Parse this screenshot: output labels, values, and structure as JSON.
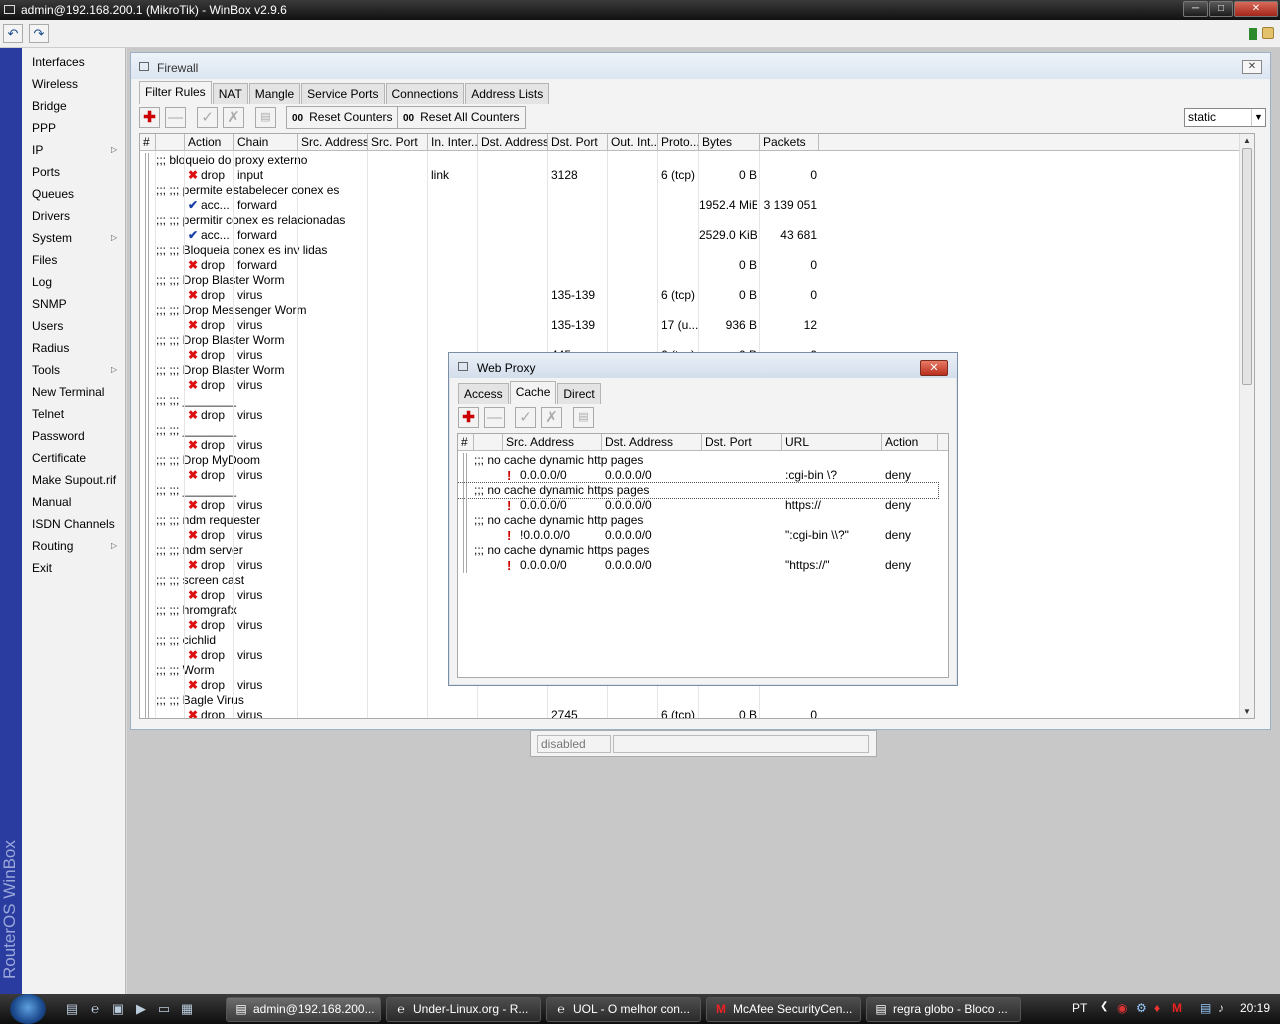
{
  "window": {
    "title": "admin@192.168.200.1 (MikroTik) - WinBox v2.9.6",
    "brand": "RouterOS WinBox"
  },
  "toolbar": {
    "undo_icon": "undo-icon",
    "redo_icon": "redo-icon"
  },
  "sidebar": {
    "items": [
      {
        "label": "Interfaces",
        "submenu": false
      },
      {
        "label": "Wireless",
        "submenu": false
      },
      {
        "label": "Bridge",
        "submenu": false
      },
      {
        "label": "PPP",
        "submenu": false
      },
      {
        "label": "IP",
        "submenu": true
      },
      {
        "label": "Ports",
        "submenu": false
      },
      {
        "label": "Queues",
        "submenu": false
      },
      {
        "label": "Drivers",
        "submenu": false
      },
      {
        "label": "System",
        "submenu": true
      },
      {
        "label": "Files",
        "submenu": false
      },
      {
        "label": "Log",
        "submenu": false
      },
      {
        "label": "SNMP",
        "submenu": false
      },
      {
        "label": "Users",
        "submenu": false
      },
      {
        "label": "Radius",
        "submenu": false
      },
      {
        "label": "Tools",
        "submenu": true
      },
      {
        "label": "New Terminal",
        "submenu": false
      },
      {
        "label": "Telnet",
        "submenu": false
      },
      {
        "label": "Password",
        "submenu": false
      },
      {
        "label": "Certificate",
        "submenu": false
      },
      {
        "label": "Make Supout.rif",
        "submenu": false
      },
      {
        "label": "Manual",
        "submenu": false
      },
      {
        "label": "ISDN Channels",
        "submenu": false
      },
      {
        "label": "Routing",
        "submenu": true
      },
      {
        "label": "Exit",
        "submenu": false
      }
    ]
  },
  "firewall": {
    "title": "Firewall",
    "tabs": [
      "Filter Rules",
      "NAT",
      "Mangle",
      "Service Ports",
      "Connections",
      "Address Lists"
    ],
    "active_tab": "Filter Rules",
    "reset_counters": "Reset Counters",
    "reset_all_counters": "Reset All Counters",
    "counter_prefix": "00",
    "filter_select": "static",
    "columns": [
      "#",
      "Action",
      "Chain",
      "Src. Address",
      "Src. Port",
      "In. Inter...",
      "Dst. Address",
      "Dst. Port",
      "Out. Int...",
      "Proto...",
      "Bytes",
      "Packets"
    ],
    "rows": [
      {
        "comment": ";;; bloqueio do proxy externo",
        "icon": "x",
        "action": "drop",
        "chain": "input",
        "in_iface": "link",
        "dst_port": "3128",
        "proto": "6 (tcp)",
        "bytes": "0 B",
        "packets": "0"
      },
      {
        "comment": ";;; ;;; permite estabelecer conex es",
        "icon": "ok",
        "action": "acc...",
        "chain": "forward",
        "in_iface": "",
        "dst_port": "",
        "proto": "",
        "bytes": "1952.4 MiB",
        "packets": "3 139 051"
      },
      {
        "comment": ";;; ;;; permitir conex es relacionadas",
        "icon": "ok",
        "action": "acc...",
        "chain": "forward",
        "in_iface": "",
        "dst_port": "",
        "proto": "",
        "bytes": "2529.0 KiB",
        "packets": "43 681"
      },
      {
        "comment": ";;; ;;; Bloqueia conex es inv lidas",
        "icon": "x",
        "action": "drop",
        "chain": "forward",
        "in_iface": "",
        "dst_port": "",
        "proto": "",
        "bytes": "0 B",
        "packets": "0"
      },
      {
        "comment": ";;; ;;; Drop Blaster Worm",
        "icon": "x",
        "action": "drop",
        "chain": "virus",
        "in_iface": "",
        "dst_port": "135-139",
        "proto": "6 (tcp)",
        "bytes": "0 B",
        "packets": "0"
      },
      {
        "comment": ";;; ;;; Drop Messenger Worm",
        "icon": "x",
        "action": "drop",
        "chain": "virus",
        "in_iface": "",
        "dst_port": "135-139",
        "proto": "17 (u...",
        "bytes": "936 B",
        "packets": "12"
      },
      {
        "comment": ";;; ;;; Drop Blaster Worm",
        "icon": "x",
        "action": "drop",
        "chain": "virus",
        "in_iface": "",
        "dst_port": "445",
        "proto": "6 (tcp)",
        "bytes": "0 B",
        "packets": "0"
      },
      {
        "comment": ";;; ;;; Drop Blaster Worm",
        "icon": "x",
        "action": "drop",
        "chain": "virus",
        "in_iface": "",
        "dst_port": "",
        "proto": "",
        "bytes": "",
        "packets": ""
      },
      {
        "comment": ";;; ;;; ________",
        "icon": "x",
        "action": "drop",
        "chain": "virus",
        "in_iface": "",
        "dst_port": "",
        "proto": "",
        "bytes": "",
        "packets": ""
      },
      {
        "comment": ";;; ;;; ________",
        "icon": "x",
        "action": "drop",
        "chain": "virus",
        "in_iface": "",
        "dst_port": "",
        "proto": "",
        "bytes": "",
        "packets": ""
      },
      {
        "comment": ";;; ;;; Drop MyDoom",
        "icon": "x",
        "action": "drop",
        "chain": "virus",
        "in_iface": "",
        "dst_port": "",
        "proto": "",
        "bytes": "",
        "packets": ""
      },
      {
        "comment": ";;; ;;; ________",
        "icon": "x",
        "action": "drop",
        "chain": "virus",
        "in_iface": "",
        "dst_port": "",
        "proto": "",
        "bytes": "",
        "packets": ""
      },
      {
        "comment": ";;; ;;; ndm requester",
        "icon": "x",
        "action": "drop",
        "chain": "virus",
        "in_iface": "",
        "dst_port": "",
        "proto": "",
        "bytes": "",
        "packets": ""
      },
      {
        "comment": ";;;  ;;; ndm server",
        "icon": "x",
        "action": "drop",
        "chain": "virus",
        "in_iface": "",
        "dst_port": "",
        "proto": "",
        "bytes": "",
        "packets": ""
      },
      {
        "comment": ";;; ;;; screen cast",
        "icon": "x",
        "action": "drop",
        "chain": "virus",
        "in_iface": "",
        "dst_port": "",
        "proto": "",
        "bytes": "",
        "packets": ""
      },
      {
        "comment": ";;; ;;; hromgrafx",
        "icon": "x",
        "action": "drop",
        "chain": "virus",
        "in_iface": "",
        "dst_port": "",
        "proto": "",
        "bytes": "",
        "packets": ""
      },
      {
        "comment": ";;; ;;; cichlid",
        "icon": "x",
        "action": "drop",
        "chain": "virus",
        "in_iface": "",
        "dst_port": "",
        "proto": "",
        "bytes": "",
        "packets": ""
      },
      {
        "comment": ";;; ;;; Worm",
        "icon": "x",
        "action": "drop",
        "chain": "virus",
        "in_iface": "",
        "dst_port": "",
        "proto": "",
        "bytes": "",
        "packets": ""
      },
      {
        "comment": ";;; ;;; Bagle Virus",
        "icon": "x",
        "action": "drop",
        "chain": "virus",
        "in_iface": "",
        "dst_port": "2745",
        "proto": "6 (tcp)",
        "bytes": "0 B",
        "packets": "0"
      }
    ],
    "status_field": "disabled"
  },
  "webproxy": {
    "title": "Web Proxy",
    "tabs": [
      "Access",
      "Cache",
      "Direct"
    ],
    "active_tab": "Cache",
    "columns": [
      "#",
      "Src. Address",
      "Dst. Address",
      "Dst. Port",
      "URL",
      "Action"
    ],
    "rows": [
      {
        "comment": ";;; no cache dynamic http pages",
        "src": "0.0.0.0/0",
        "dst": "0.0.0.0/0",
        "dst_port": "",
        "url": ":cgi-bin \\?",
        "action": "deny"
      },
      {
        "comment": ";;; no cache dynamic https pages",
        "src": "0.0.0.0/0",
        "dst": "0.0.0.0/0",
        "dst_port": "",
        "url": "https://",
        "action": "deny"
      },
      {
        "comment": ";;; no cache dynamic http pages",
        "src": "!0.0.0.0/0",
        "dst": "0.0.0.0/0",
        "dst_port": "",
        "url": "\":cgi-bin \\\\?\"",
        "action": "deny"
      },
      {
        "comment": ";;; no cache dynamic https pages",
        "src": "0.0.0.0/0",
        "dst": "0.0.0.0/0",
        "dst_port": "",
        "url": "\"https://\"",
        "action": "deny"
      }
    ]
  },
  "taskbar": {
    "buttons": [
      {
        "label": "admin@192.168.200...",
        "icon": "winbox-icon",
        "active": true
      },
      {
        "label": "Under-Linux.org - R...",
        "icon": "ie-icon",
        "active": false
      },
      {
        "label": "UOL - O melhor con...",
        "icon": "ie-icon",
        "active": false
      },
      {
        "label": "McAfee SecurityCen...",
        "icon": "mcafee-icon",
        "active": false
      },
      {
        "label": "regra globo - Bloco ...",
        "icon": "notepad-icon",
        "active": false
      }
    ],
    "language": "PT",
    "clock": "20:19"
  }
}
